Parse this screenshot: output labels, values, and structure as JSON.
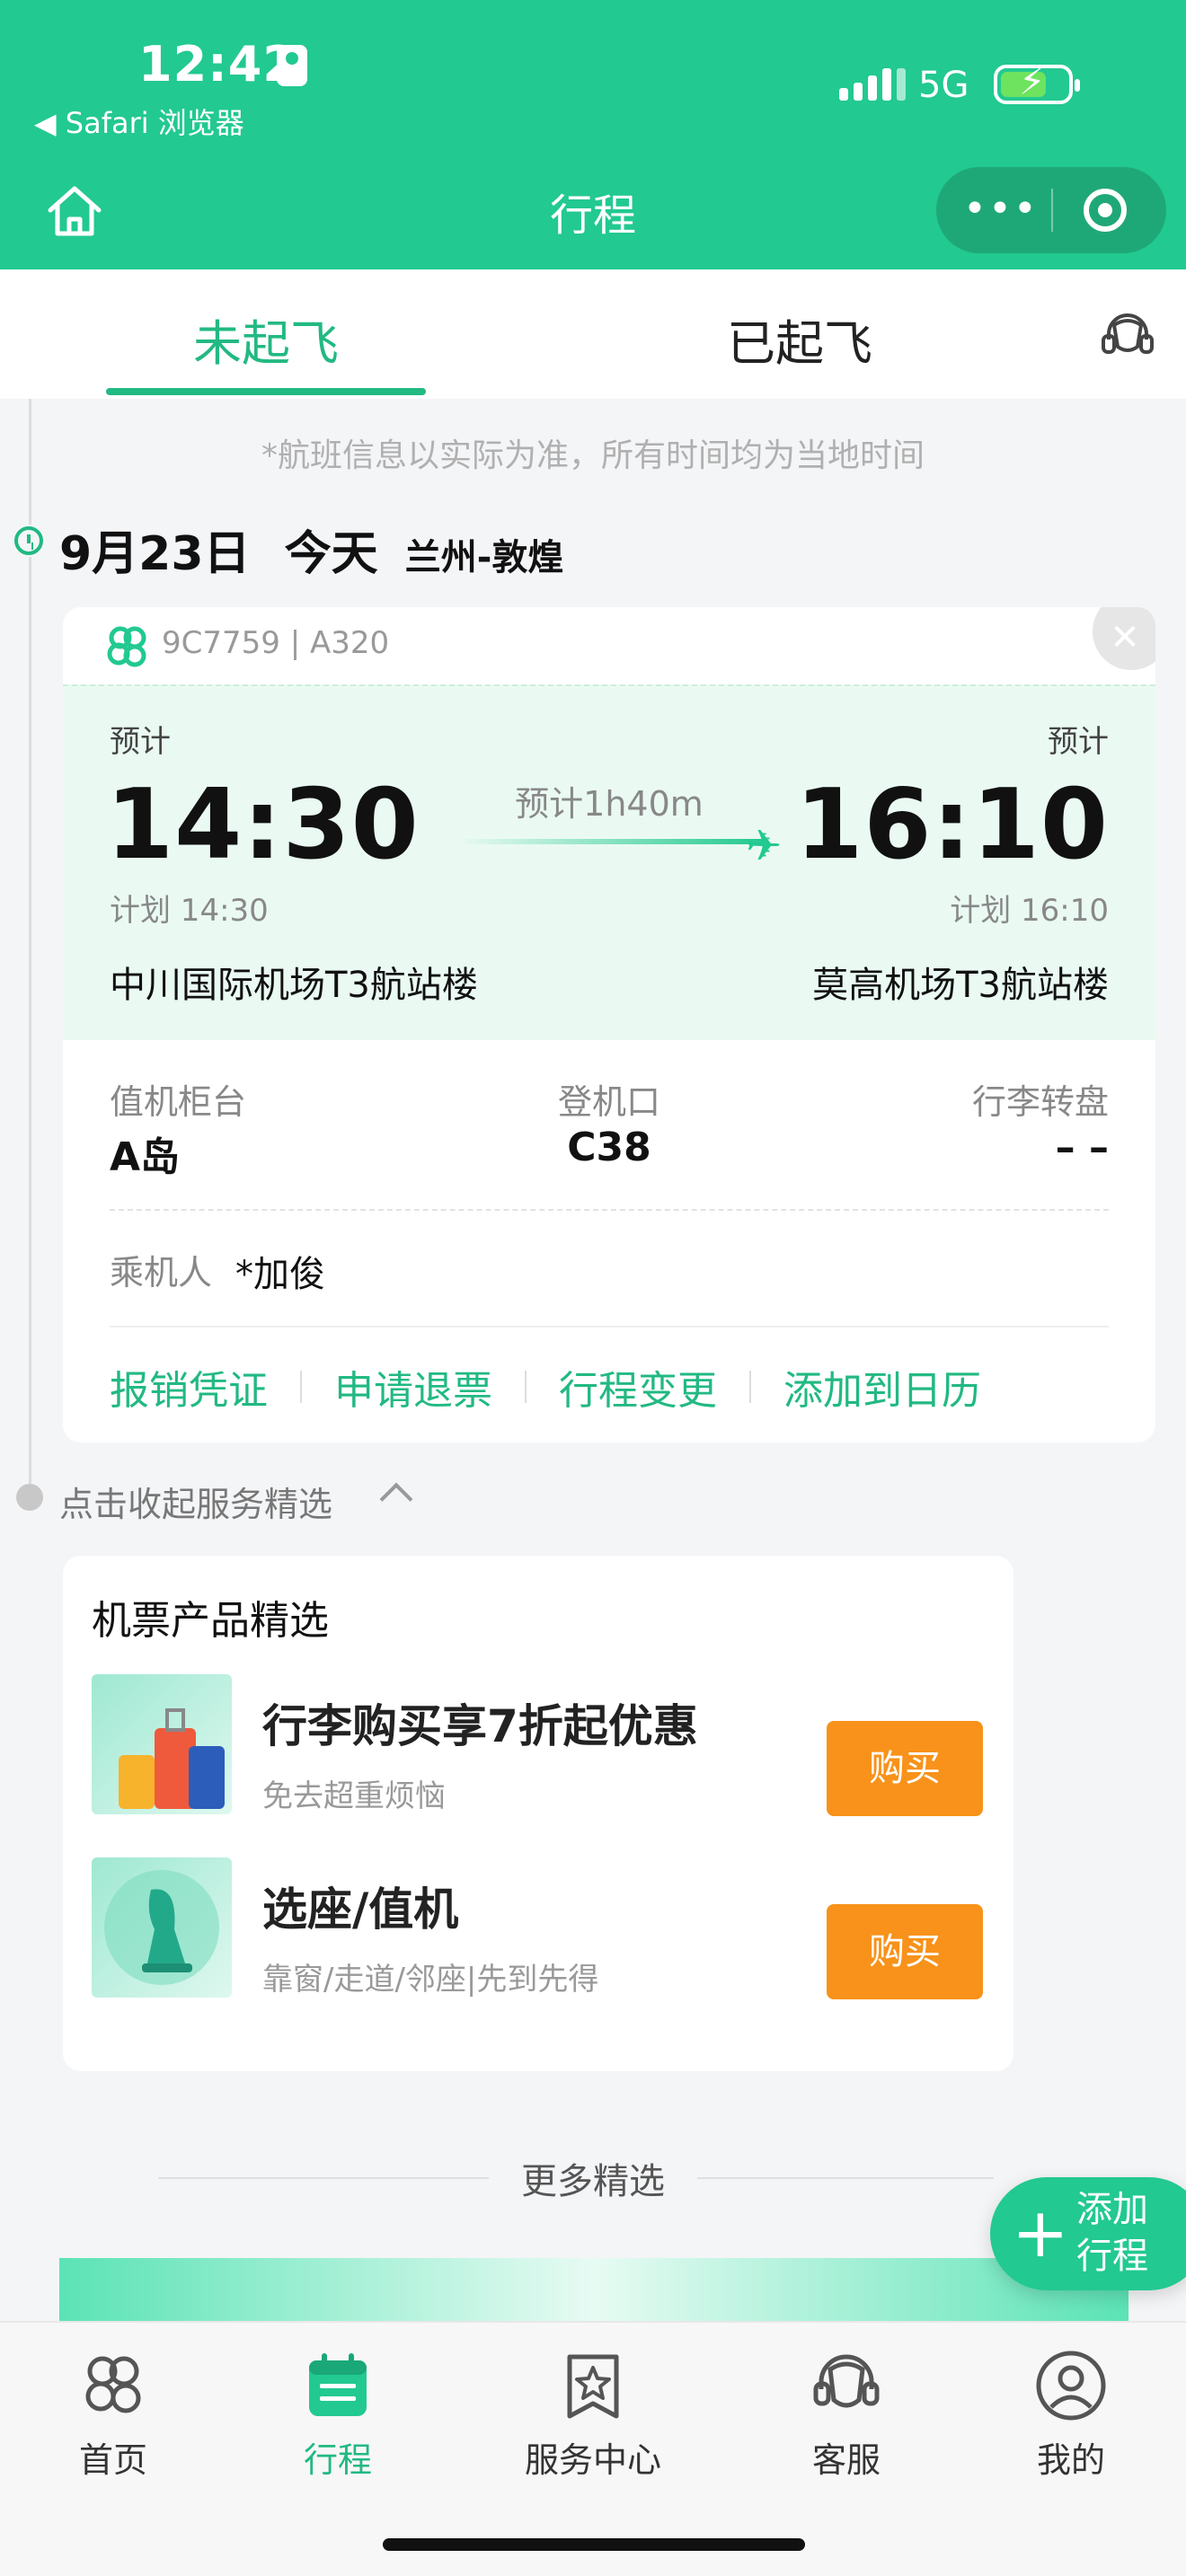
{
  "status_bar": {
    "time": "12:42",
    "back_app": "◀ Safari 浏览器",
    "network": "5G"
  },
  "nav": {
    "title": "行程",
    "more_icon": "more-dots-icon",
    "close_icon": "target-icon"
  },
  "tabs": [
    {
      "label": "未起飞",
      "active": true
    },
    {
      "label": "已起飞",
      "active": false
    }
  ],
  "notice": "*航班信息以实际为准，所有时间均为当地时间",
  "trip": {
    "date": "9月23日",
    "day": "今天",
    "route": "兰州-敦煌"
  },
  "flight": {
    "number_model": "9C7759 | A320",
    "dep_est_label": "预计",
    "arr_est_label": "预计",
    "dep_time": "14:30",
    "arr_time": "16:10",
    "duration": "预计1h40m",
    "dep_plan": "计划 14:30",
    "arr_plan": "计划 16:10",
    "dep_airport": "中川国际机场T3航站楼",
    "arr_airport": "莫高机场T3航站楼",
    "checkin_label": "值机柜台",
    "checkin_value": "A岛",
    "gate_label": "登机口",
    "gate_value": "C38",
    "baggage_label": "行李转盘",
    "baggage_value": "– –",
    "passenger_label": "乘机人",
    "passenger_value": "*加俊",
    "actions": [
      "报销凭证",
      "申请退票",
      "行程变更",
      "添加到日历"
    ]
  },
  "collapse_label": "点击收起服务精选",
  "products": {
    "title": "机票产品精选",
    "items": [
      {
        "name": "行李购买享7折起优惠",
        "sub": "免去超重烦恼",
        "button": "购买"
      },
      {
        "name": "选座/值机",
        "sub": "靠窗/走道/邻座|先到先得",
        "button": "购买"
      }
    ]
  },
  "more_selection": "更多精选",
  "fab": {
    "line1": "添加",
    "line2": "行程"
  },
  "bottom_nav": [
    {
      "label": "首页",
      "icon": "home-logo-icon"
    },
    {
      "label": "行程",
      "icon": "calendar-icon",
      "active": true
    },
    {
      "label": "服务中心",
      "icon": "service-star-icon"
    },
    {
      "label": "客服",
      "icon": "headset-icon"
    },
    {
      "label": "我的",
      "icon": "user-icon"
    }
  ],
  "colors": {
    "brand": "#22c990",
    "accent_text": "#22b982",
    "buy": "#f8921a"
  }
}
